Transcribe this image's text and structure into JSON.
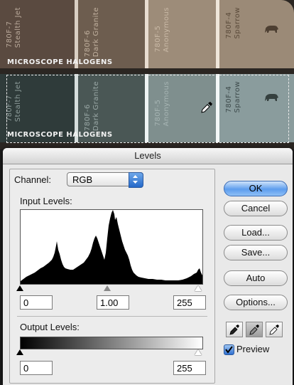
{
  "photo": {
    "caption_top": "MICROSCOPE HALOGENS",
    "caption_bottom": "MICROSCOPE HALOGENS",
    "chips": [
      {
        "code": "780F-7",
        "name": "Stealth Jet"
      },
      {
        "code": "780F-6",
        "name": "Dark Granite"
      },
      {
        "code": "780F-5",
        "name": "Anonymous"
      },
      {
        "code": "780F-4",
        "name": "Sparrow"
      }
    ]
  },
  "dialog": {
    "title": "Levels",
    "channel_label": "Channel:",
    "channel_value": "RGB",
    "input_levels_label": "Input Levels:",
    "input_black": "0",
    "input_gamma": "1.00",
    "input_white": "255",
    "output_levels_label": "Output Levels:",
    "output_black": "0",
    "output_white": "255",
    "buttons": {
      "ok": "OK",
      "cancel": "Cancel",
      "load": "Load...",
      "save": "Save...",
      "auto": "Auto",
      "options": "Options..."
    },
    "preview_label": "Preview",
    "preview_checked": true
  }
}
